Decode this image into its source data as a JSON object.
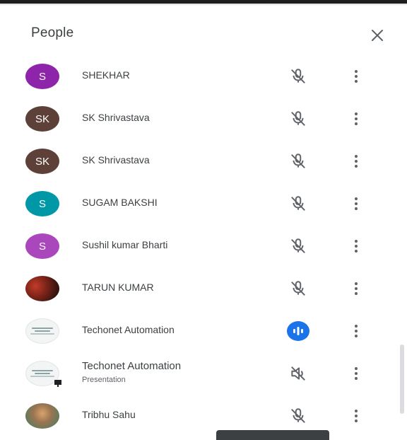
{
  "header": {
    "title": "People"
  },
  "participants": [
    {
      "name": "SHEKHAR",
      "initials": "S",
      "avatar_color": "#8e24aa",
      "mic": "muted"
    },
    {
      "name": "SK Shrivastava",
      "initials": "SK",
      "avatar_color": "#5d4037",
      "mic": "muted"
    },
    {
      "name": "SK Shrivastava",
      "initials": "SK",
      "avatar_color": "#5d4037",
      "mic": "muted"
    },
    {
      "name": "SUGAM BAKSHI",
      "initials": "S",
      "avatar_color": "#0097a7",
      "mic": "muted"
    },
    {
      "name": "Sushil kumar Bharti",
      "initials": "S",
      "avatar_color": "#ab47bc",
      "mic": "muted"
    },
    {
      "name": "TARUN KUMAR",
      "initials": "",
      "avatar_color": "#7a2318",
      "mic": "muted"
    },
    {
      "name": "Techonet Automation",
      "initials": "",
      "avatar_color": "#f3f5f5",
      "mic": "speaking"
    },
    {
      "name": "Techonet Automation",
      "subtitle": "Presentation",
      "initials": "",
      "avatar_color": "#f3f5f5",
      "mic": "presenting"
    },
    {
      "name": "Tribhu Sahu",
      "initials": "",
      "avatar_color": "#9a7452",
      "mic": "muted"
    }
  ],
  "colors": {
    "speaking_accent": "#1a73e8",
    "icon_gray": "#5f6368"
  }
}
